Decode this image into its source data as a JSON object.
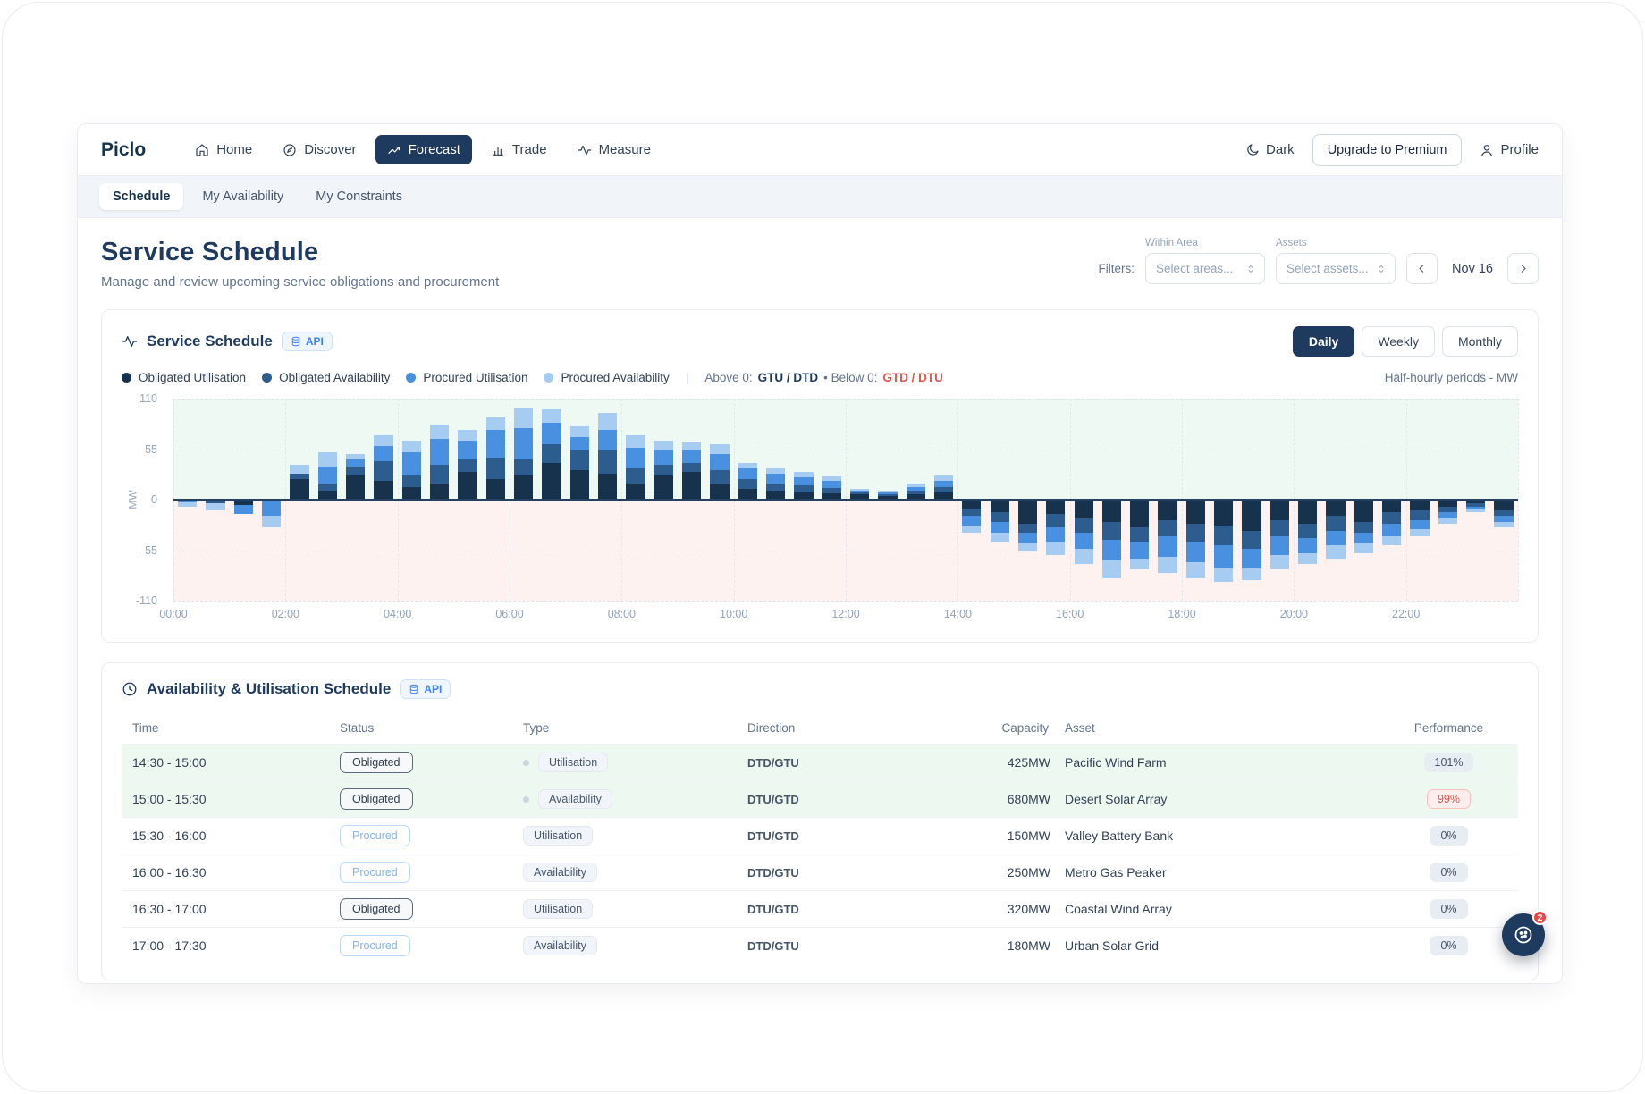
{
  "nav": {
    "brand": "Piclo",
    "items": [
      {
        "label": "Home",
        "icon": "home-icon",
        "active": false
      },
      {
        "label": "Discover",
        "icon": "compass-icon",
        "active": false
      },
      {
        "label": "Forecast",
        "icon": "trend-icon",
        "active": true
      },
      {
        "label": "Trade",
        "icon": "bars-icon",
        "active": false
      },
      {
        "label": "Measure",
        "icon": "pulse-icon",
        "active": false
      }
    ],
    "dark_label": "Dark",
    "upgrade_label": "Upgrade to Premium",
    "profile_label": "Profile"
  },
  "subnav": {
    "items": [
      {
        "label": "Schedule",
        "active": true
      },
      {
        "label": "My Availability",
        "active": false
      },
      {
        "label": "My Constraints",
        "active": false
      }
    ]
  },
  "page": {
    "title": "Service Schedule",
    "subtitle": "Manage and review upcoming service obligations and procurement"
  },
  "filters": {
    "label": "Filters:",
    "area_label": "Within Area",
    "area_placeholder": "Select areas...",
    "assets_label": "Assets",
    "assets_placeholder": "Select assets...",
    "date": "Nov 16"
  },
  "schedule_card": {
    "title": "Service Schedule",
    "api_label": "API",
    "range_buttons": [
      "Daily",
      "Weekly",
      "Monthly"
    ],
    "active_range": "Daily",
    "note_above": "Above 0:",
    "note_above_value": "GTU / DTD",
    "note_below": "• Below 0:",
    "note_below_value": "GTD / DTU",
    "units_note": "Half-hourly periods - MW"
  },
  "legend": [
    {
      "label": "Obligated Utilisation",
      "color": "#16324c"
    },
    {
      "label": "Obligated Availability",
      "color": "#2d5c8f"
    },
    {
      "label": "Procured Utilisation",
      "color": "#4a90e0"
    },
    {
      "label": "Procured Availability",
      "color": "#a6ccf2"
    }
  ],
  "chart_data": {
    "type": "bar",
    "stacked": true,
    "title": "Service Schedule",
    "ylabel": "MW",
    "ylim": [
      -110,
      110
    ],
    "yticks": [
      110,
      55,
      0,
      -55,
      -110
    ],
    "xticks": [
      "00:00",
      "02:00",
      "04:00",
      "06:00",
      "08:00",
      "10:00",
      "12:00",
      "14:00",
      "16:00",
      "18:00",
      "20:00",
      "22:00"
    ],
    "x": [
      "00:00",
      "00:30",
      "01:00",
      "01:30",
      "02:00",
      "02:30",
      "03:00",
      "03:30",
      "04:00",
      "04:30",
      "05:00",
      "05:30",
      "06:00",
      "06:30",
      "07:00",
      "07:30",
      "08:00",
      "08:30",
      "09:00",
      "09:30",
      "10:00",
      "10:30",
      "11:00",
      "11:30",
      "12:00",
      "12:30",
      "13:00",
      "13:30",
      "14:00",
      "14:30",
      "15:00",
      "15:30",
      "16:00",
      "16:30",
      "17:00",
      "17:30",
      "18:00",
      "18:30",
      "19:00",
      "19:30",
      "20:00",
      "20:30",
      "21:00",
      "21:30",
      "22:00",
      "22:30",
      "23:00",
      "23:30"
    ],
    "series": [
      {
        "name": "Obligated Utilisation",
        "color": "#16324c",
        "values": [
          0,
          0,
          -6,
          0,
          22,
          10,
          26,
          20,
          14,
          18,
          30,
          22,
          26,
          40,
          32,
          28,
          18,
          26,
          30,
          18,
          12,
          10,
          8,
          7,
          6,
          4,
          6,
          8,
          -10,
          -14,
          -26,
          -16,
          -20,
          -24,
          -30,
          -22,
          -26,
          -28,
          -34,
          -22,
          -26,
          -18,
          -24,
          -14,
          -12,
          -8,
          -4,
          -12
        ]
      },
      {
        "name": "Obligated Availability",
        "color": "#2d5c8f",
        "values": [
          0,
          -4,
          0,
          0,
          6,
          8,
          10,
          22,
          12,
          20,
          14,
          24,
          18,
          20,
          22,
          26,
          16,
          12,
          10,
          14,
          10,
          8,
          8,
          6,
          2,
          2,
          4,
          6,
          -8,
          -10,
          -10,
          -14,
          -16,
          -20,
          -16,
          -18,
          -20,
          -22,
          -20,
          -18,
          -16,
          -16,
          -12,
          -12,
          -10,
          -6,
          -4,
          -6
        ]
      },
      {
        "name": "Procured Utilisation",
        "color": "#4a90e0",
        "values": [
          -3,
          0,
          -10,
          -18,
          0,
          18,
          8,
          16,
          26,
          28,
          20,
          30,
          34,
          24,
          14,
          22,
          22,
          16,
          14,
          18,
          12,
          10,
          8,
          7,
          2,
          2,
          4,
          6,
          -10,
          -12,
          -12,
          -16,
          -18,
          -22,
          -18,
          -22,
          -22,
          -24,
          -20,
          -20,
          -16,
          -16,
          -12,
          -14,
          -10,
          -6,
          -3,
          -6
        ]
      },
      {
        "name": "Procured Availability",
        "color": "#a6ccf2",
        "values": [
          -5,
          -8,
          0,
          -12,
          10,
          16,
          6,
          12,
          12,
          16,
          12,
          14,
          22,
          14,
          12,
          18,
          14,
          10,
          8,
          10,
          6,
          6,
          6,
          5,
          2,
          2,
          4,
          6,
          -8,
          -10,
          -8,
          -14,
          -16,
          -20,
          -12,
          -18,
          -18,
          -16,
          -14,
          -16,
          -12,
          -14,
          -10,
          -10,
          -8,
          -6,
          -3,
          -6
        ]
      }
    ],
    "legend_position": "top",
    "grid": true
  },
  "table_card": {
    "title": "Availability & Utilisation Schedule",
    "api_label": "API",
    "columns": [
      "Time",
      "Status",
      "Type",
      "Direction",
      "Capacity",
      "Asset",
      "Performance"
    ],
    "rows": [
      {
        "time": "14:30 - 15:00",
        "status": "Obligated",
        "type": "Utilisation",
        "type_dot": true,
        "direction": "DTD/GTU",
        "capacity": "425MW",
        "asset": "Pacific Wind Farm",
        "performance": "101%",
        "perf_variant": "neutral",
        "highlight": true
      },
      {
        "time": "15:00 - 15:30",
        "status": "Obligated",
        "type": "Availability",
        "type_dot": true,
        "direction": "DTU/GTD",
        "capacity": "680MW",
        "asset": "Desert Solar Array",
        "performance": "99%",
        "perf_variant": "alert",
        "highlight": true
      },
      {
        "time": "15:30 - 16:00",
        "status": "Procured",
        "type": "Utilisation",
        "type_dot": false,
        "direction": "DTU/GTD",
        "capacity": "150MW",
        "asset": "Valley Battery Bank",
        "performance": "0%",
        "perf_variant": "neutral",
        "highlight": false
      },
      {
        "time": "16:00 - 16:30",
        "status": "Procured",
        "type": "Availability",
        "type_dot": false,
        "direction": "DTD/GTU",
        "capacity": "250MW",
        "asset": "Metro Gas Peaker",
        "performance": "0%",
        "perf_variant": "neutral",
        "highlight": false
      },
      {
        "time": "16:30 - 17:00",
        "status": "Obligated",
        "type": "Utilisation",
        "type_dot": false,
        "direction": "DTU/GTD",
        "capacity": "320MW",
        "asset": "Coastal Wind Array",
        "performance": "0%",
        "perf_variant": "neutral",
        "highlight": false
      },
      {
        "time": "17:00 - 17:30",
        "status": "Procured",
        "type": "Availability",
        "type_dot": false,
        "direction": "DTD/GTU",
        "capacity": "180MW",
        "asset": "Urban Solar Grid",
        "performance": "0%",
        "perf_variant": "neutral",
        "highlight": false
      }
    ]
  },
  "fab": {
    "badge": "2"
  }
}
